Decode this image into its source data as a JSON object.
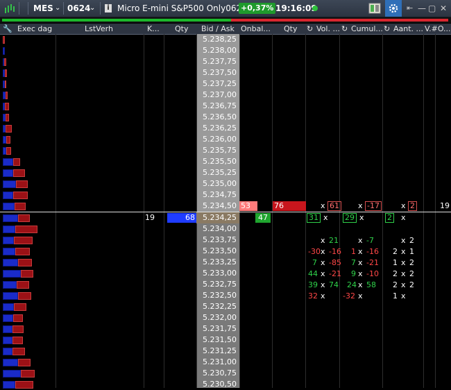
{
  "toolbar": {
    "symbol": "MES",
    "contract": "0624",
    "info_label": "i",
    "description": "Micro E-mini S&P500 Only0624",
    "change": "+0,37%",
    "time": "19:16:09",
    "colors": {
      "green": "#1f9a2c",
      "status": "#2ec13c"
    }
  },
  "headers": [
    "Exec dag",
    "LstVerh",
    "K...",
    "Qty",
    "Bid / Ask",
    "Onbal...",
    "Qty",
    "Vol. ...",
    "Cumul...",
    "Aant. ...",
    "V.#O..."
  ],
  "prices_upper": [
    "5.238,25",
    "5.238,00",
    "5.237,75",
    "5.237,50",
    "5.237,25",
    "5.237,00",
    "5.236,75",
    "5.236,50",
    "5.236,25",
    "5.236,00",
    "5.235,75",
    "5.235,50",
    "5.235,25",
    "5.235,00",
    "5.234,75",
    "5.234,50"
  ],
  "prices_lower": [
    "5.234,25",
    "5.234,00",
    "5.233,75",
    "5.233,50",
    "5.233,25",
    "5.233,00",
    "5.232,75",
    "5.232,50",
    "5.232,25",
    "5.232,00",
    "5.231,75",
    "5.231,50",
    "5.231,25",
    "5.231,00",
    "5.230,75",
    "5.230,50"
  ],
  "ask_row": {
    "onbal": "53",
    "qty": "76",
    "vol": "61",
    "cumul": "-17",
    "aant": "2",
    "vo": "19"
  },
  "bid_row": {
    "k": "19",
    "qty": "68",
    "onbal": "47",
    "vol": "31",
    "cumul": "29",
    "aant": "2"
  },
  "x_mark": "x",
  "lower_rows": [
    {
      "v1": "",
      "v2": "21",
      "c1": "",
      "c2": "-7",
      "a1": "",
      "a2": "2"
    },
    {
      "v1": "-30",
      "v2": "-16",
      "c1": "1",
      "c2": "-16",
      "a1": "2",
      "a2": "1"
    },
    {
      "v1": "7",
      "v2": "-85",
      "c1": "7",
      "c2": "-21",
      "a1": "1",
      "a2": "2"
    },
    {
      "v1": "44",
      "v2": "-21",
      "c1": "9",
      "c2": "-10",
      "a1": "2",
      "a2": "2"
    },
    {
      "v1": "39",
      "v2": "74",
      "c1": "24",
      "c2": "58",
      "a1": "2",
      "a2": "2"
    },
    {
      "v1": "32",
      "v2": "",
      "c1": "-32",
      "c2": "",
      "a1": "1",
      "a2": ""
    }
  ]
}
